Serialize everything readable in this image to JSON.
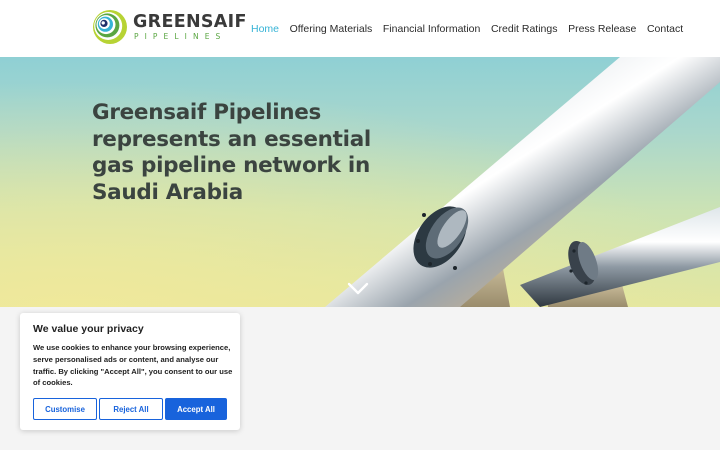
{
  "brand": {
    "name": "GREENSAIF",
    "subtitle": "PIPELINES",
    "logo_icon": "concentric-rings-logo-icon",
    "colors": {
      "cyan": "#36b3d6",
      "green": "#5aa642",
      "lime": "#b7d334"
    }
  },
  "nav": {
    "items": [
      {
        "label": "Home",
        "active": true
      },
      {
        "label": "Offering Materials",
        "active": false
      },
      {
        "label": "Financial Information",
        "active": false
      },
      {
        "label": "Credit Ratings",
        "active": false
      },
      {
        "label": "Press Release",
        "active": false
      },
      {
        "label": "Contact",
        "active": false
      }
    ],
    "active_color": "#36b3d6"
  },
  "hero": {
    "title": "Greensaif Pipelines represents an essential gas pipeline network in Saudi Arabia",
    "scroll_icon": "chevron-down-icon"
  },
  "cookie_banner": {
    "title": "We value your privacy",
    "text": "We use cookies to enhance your browsing experience, serve personalised ads or content, and analyse our traffic. By clicking \"Accept All\", you consent to our use of cookies.",
    "buttons": {
      "customise": "Customise",
      "reject": "Reject All",
      "accept": "Accept All"
    },
    "accent_color": "#1863dc"
  }
}
